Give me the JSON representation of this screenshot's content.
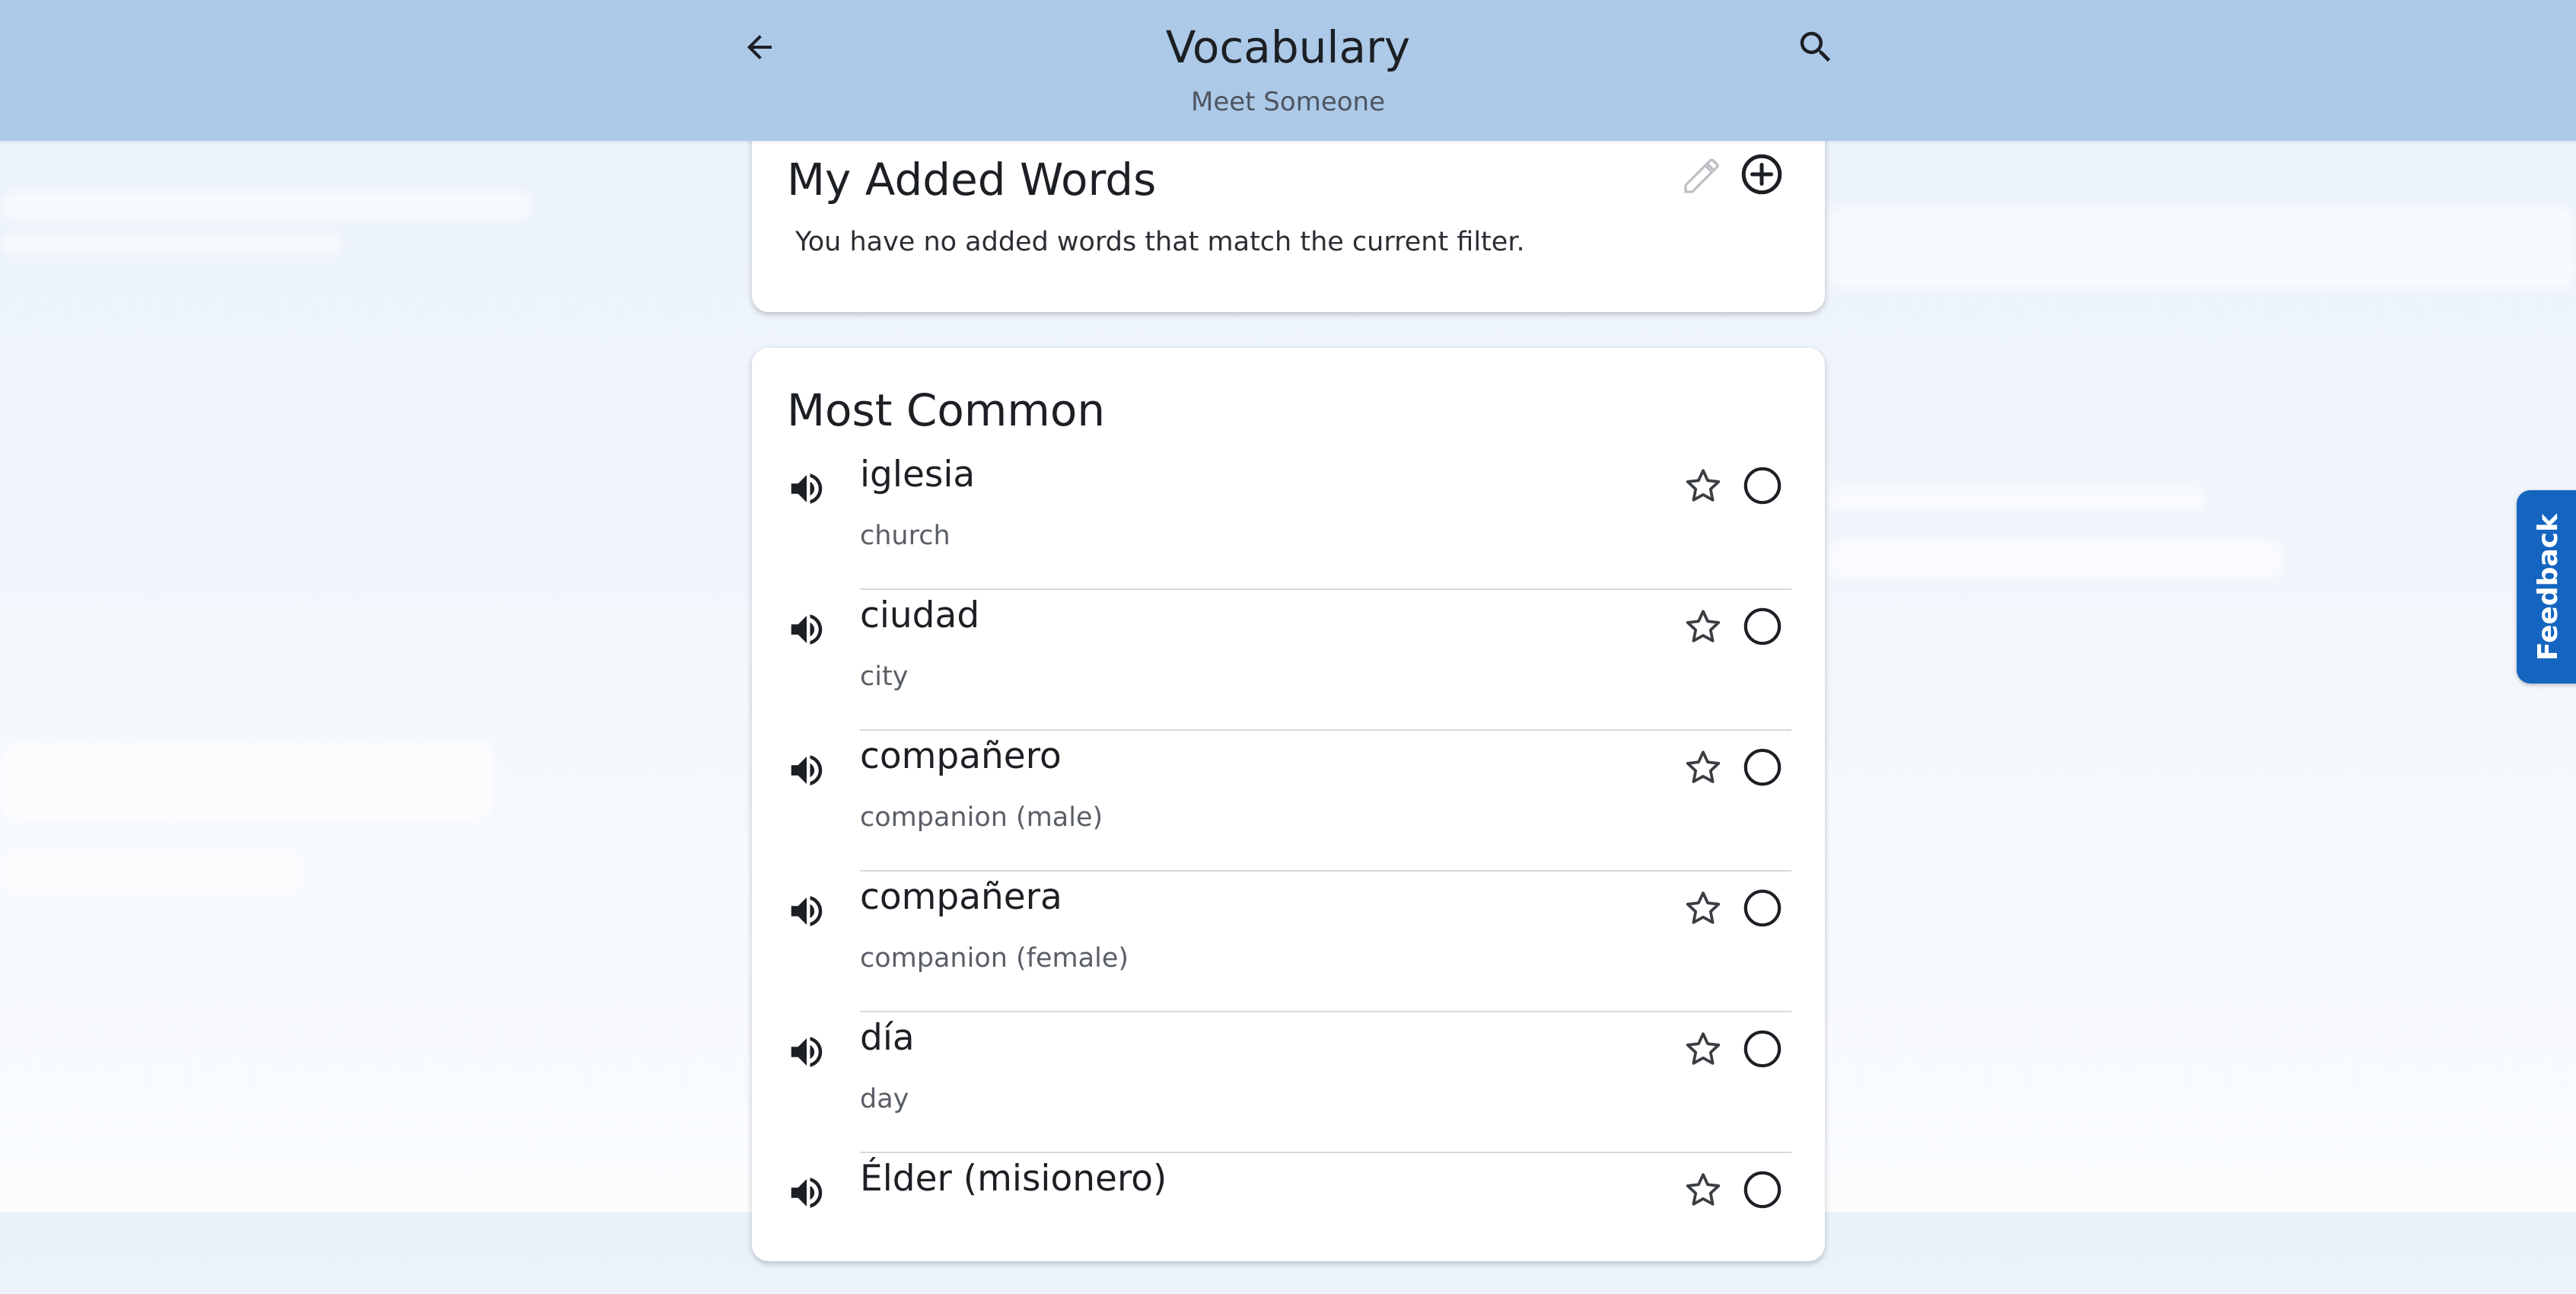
{
  "header": {
    "title": "Vocabulary",
    "subtitle": "Meet Someone",
    "back_icon": "arrow-back-icon",
    "search_icon": "search-icon"
  },
  "added_words": {
    "title": "My Added Words",
    "empty_message": "You have no added words that match the current filter.",
    "edit_icon": "pencil-icon",
    "add_icon": "add-circle-icon"
  },
  "most_common": {
    "title": "Most Common",
    "words": [
      {
        "term": "iglesia",
        "translation": "church"
      },
      {
        "term": "ciudad",
        "translation": "city"
      },
      {
        "term": "compañero",
        "translation": "companion (male)"
      },
      {
        "term": "compañera",
        "translation": "companion (female)"
      },
      {
        "term": "día",
        "translation": "day"
      },
      {
        "term": "Élder (misionero)",
        "translation": ""
      }
    ]
  },
  "feedback": {
    "label": "Feedback"
  },
  "colors": {
    "header_bg": "#adc9e8",
    "feedback_bg": "#1565c0"
  }
}
